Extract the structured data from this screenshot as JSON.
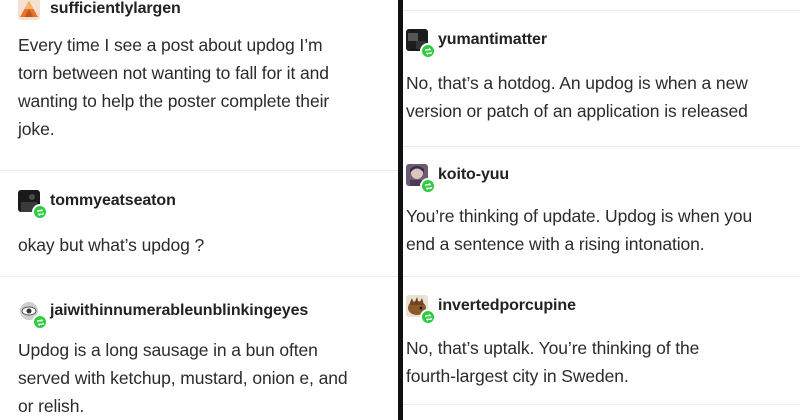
{
  "left_column": {
    "posts": [
      {
        "username": "sufficientlylargen",
        "avatar": "pyramid-logo-avatar-icon",
        "text_lines": [
          "Every time I see a post about updog I’m",
          "torn between not wanting to fall for it and",
          "wanting to help the poster complete their",
          "joke."
        ]
      },
      {
        "username": "tommyeatseaton",
        "avatar": "dark-photo-avatar-icon",
        "text_lines": [
          "okay but what’s updog ?"
        ]
      },
      {
        "username": "jaiwithinnumerableunblinkingeyes",
        "avatar": "eye-avatar-icon",
        "text_lines": [
          "Updog is a long sausage in a bun often",
          "served with ketchup, mustard, onion e, and",
          "or relish."
        ]
      }
    ]
  },
  "right_column": {
    "posts": [
      {
        "username": "yumantimatter",
        "avatar": "dark-photo-avatar-icon",
        "text_lines": [
          "No, that’s a hotdog. An updog is when a new",
          "version or patch of an application is released"
        ]
      },
      {
        "username": "koito-yuu",
        "avatar": "character-avatar-icon",
        "text_lines": [
          "You’re thinking of update. Updog is when you",
          "end a sentence with a rising intonation."
        ]
      },
      {
        "username": "invertedporcupine",
        "avatar": "porcupine-avatar-icon",
        "text_lines": [
          "No, that’s uptalk.  You’re thinking of the",
          "fourth-largest city in Sweden."
        ]
      }
    ]
  },
  "colors": {
    "reblog_badge": "#2ecc40",
    "column_divider": "#111111",
    "post_separator": "#ececec",
    "text": "#2b2b2b"
  },
  "icons": {
    "reblog": "reblog-icon"
  }
}
